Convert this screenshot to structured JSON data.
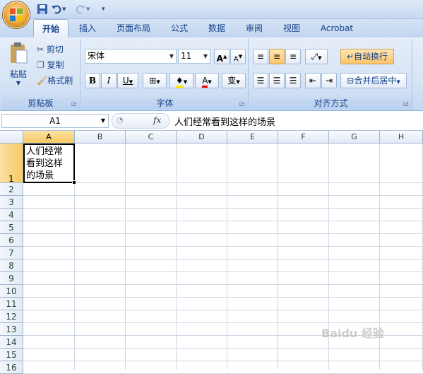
{
  "quick_access": {
    "save_icon": "save-icon",
    "undo_icon": "undo-icon",
    "redo_icon": "redo-icon",
    "customize_icon": "customize-qat-icon"
  },
  "tabs": [
    "开始",
    "插入",
    "页面布局",
    "公式",
    "数据",
    "审阅",
    "视图",
    "Acrobat"
  ],
  "active_tab": "开始",
  "clipboard": {
    "paste_label": "粘贴",
    "cut_label": "剪切",
    "copy_label": "复制",
    "format_painter_label": "格式刷",
    "group_label": "剪贴板"
  },
  "font": {
    "font_name": "宋体",
    "font_size": "11",
    "grow_label": "A",
    "shrink_label": "A",
    "bold": "B",
    "italic": "I",
    "underline": "U",
    "font_color_label": "A",
    "phonetic_label": "变",
    "group_label": "字体"
  },
  "alignment": {
    "wrap_text_label": "自动换行",
    "merge_center_label": "合并后居中",
    "group_label": "对齐方式"
  },
  "formula_bar": {
    "name_box": "A1",
    "fx_label": "fx",
    "formula": "人们经常看到这样的场景"
  },
  "sheet": {
    "columns": [
      "A",
      "B",
      "C",
      "D",
      "E",
      "F",
      "G",
      "H"
    ],
    "rows": [
      "1",
      "2",
      "3",
      "4",
      "5",
      "6",
      "7",
      "8",
      "9",
      "10",
      "11",
      "12",
      "13",
      "14",
      "15",
      "16"
    ],
    "selected_cell": "A1",
    "cells": {
      "A1": "人们经常看到这样的场景"
    },
    "a1_display_lines": "人们经常\n看到这样\n的场景"
  },
  "watermark": "Baidu 经验",
  "colors": {
    "selection_header": "#f8c965",
    "ribbon_bg": "#d6e4f5",
    "accent": "#15428b"
  }
}
